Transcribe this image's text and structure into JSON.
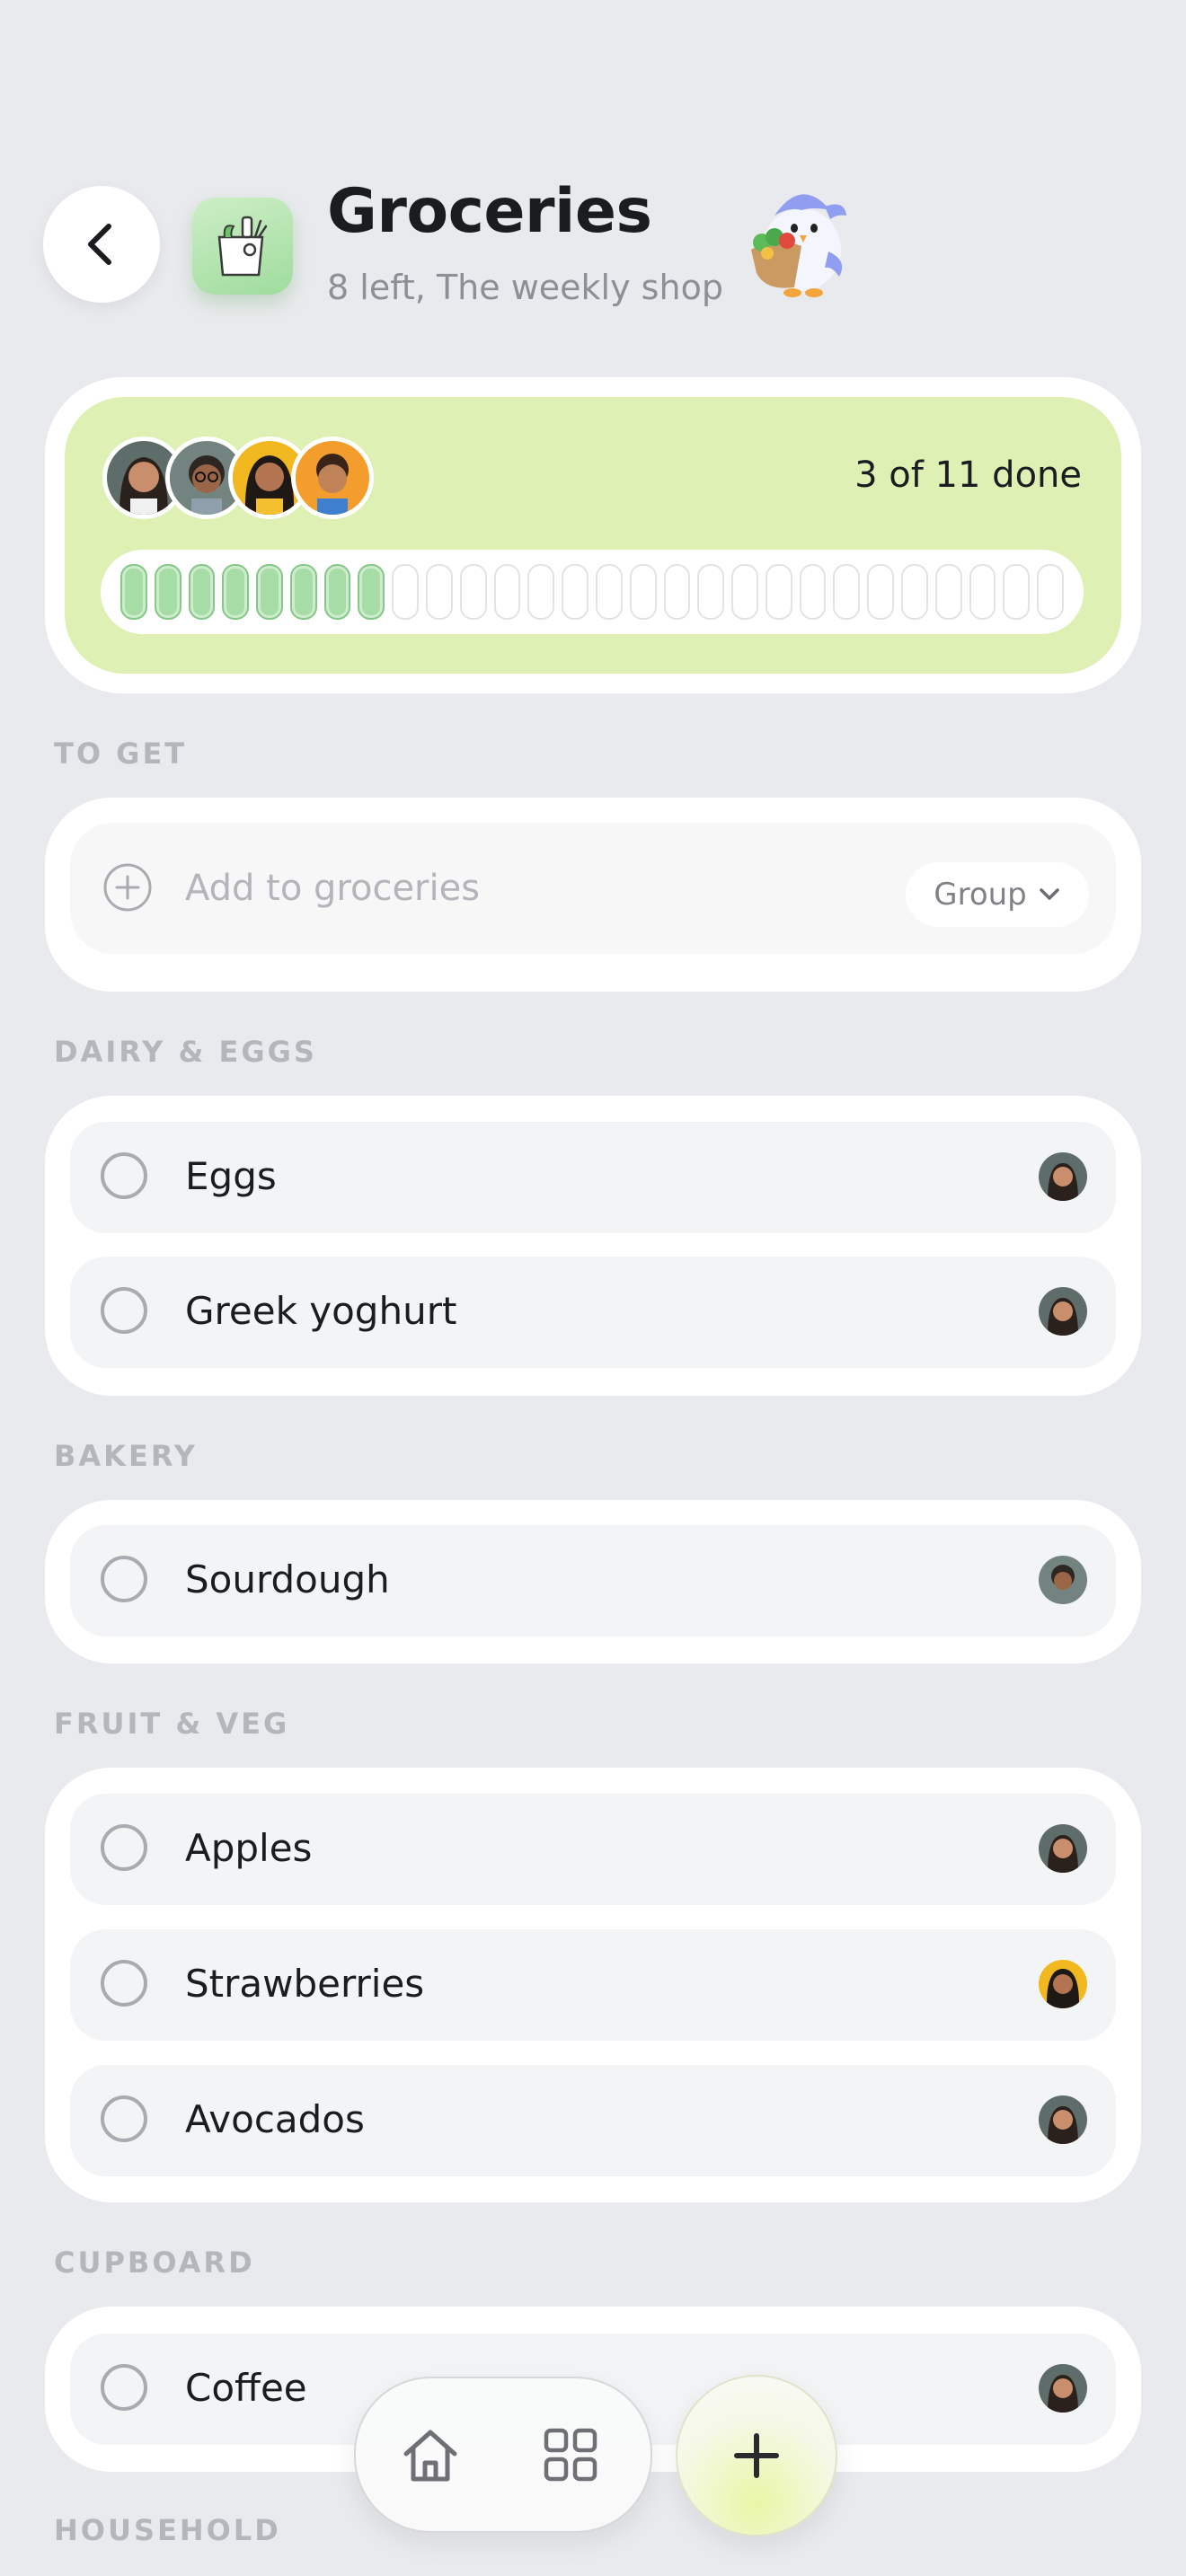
{
  "header": {
    "title": "Groceries",
    "subtitle": "8 left, The weekly shop",
    "icon": "grocery-bag-icon",
    "mascot": "bird-mascot-with-vegetables"
  },
  "progress": {
    "done_label": "3 of 11 done",
    "completed_fraction": 0.2727,
    "accent": "#dff0b4",
    "fill_color": "#a6dca5"
  },
  "sections": {
    "to_get": "TO GET",
    "dairy": "DAIRY & EGGS",
    "bakery": "BAKERY",
    "fruit": "FRUIT & VEG",
    "cupboard": "CUPBOARD",
    "household": "HOUSEHOLD"
  },
  "add_item": {
    "placeholder": "Add to groceries",
    "group_label": "Group"
  },
  "items": {
    "eggs": "Eggs",
    "yoghurt": "Greek yoghurt",
    "sourdough": "Sourdough",
    "apples": "Apples",
    "strawberries": "Strawberries",
    "avocados": "Avocados",
    "coffee": "Coffee"
  },
  "nav": {
    "home_icon": "home-icon",
    "grid_icon": "grid-icon",
    "add_icon": "plus-icon"
  }
}
